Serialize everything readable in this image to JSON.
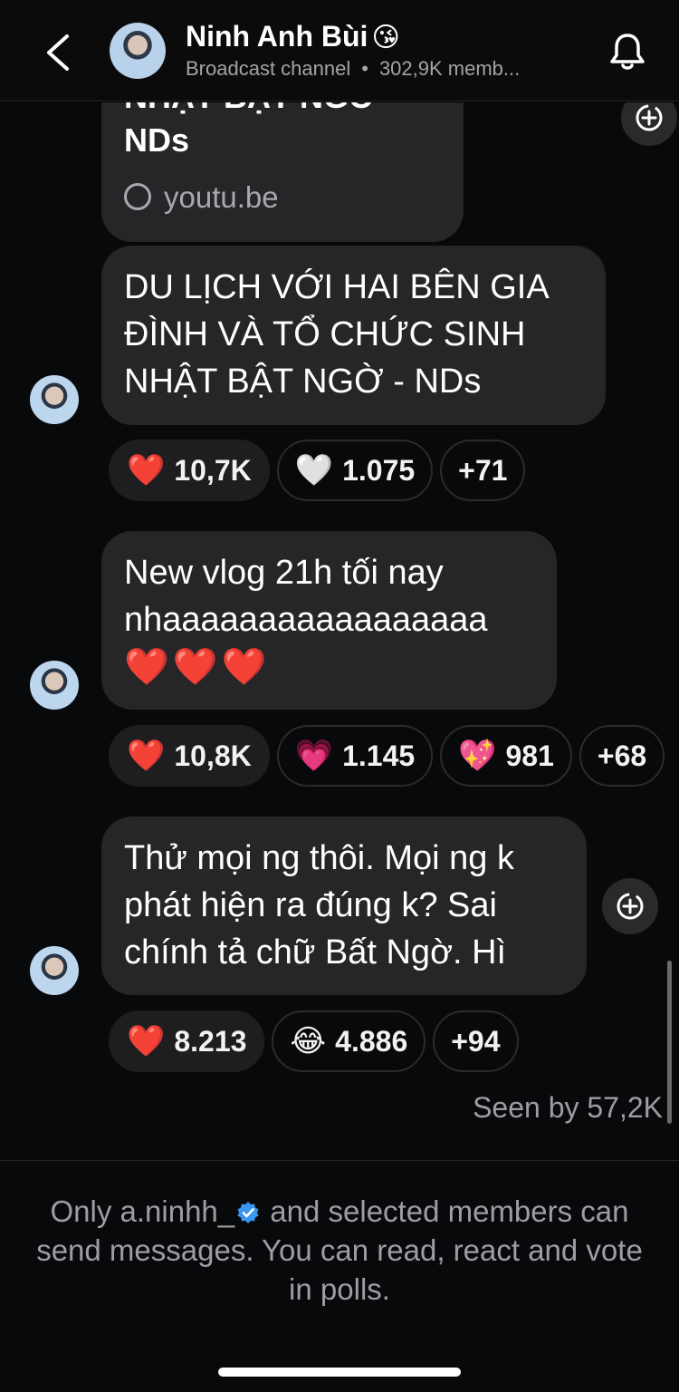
{
  "header": {
    "channel_name": "Ninh Anh Bùi",
    "name_emoji": "😘",
    "channel_type": "Broadcast channel",
    "separator": "•",
    "members": "302,9K memb..."
  },
  "messages": [
    {
      "type": "link_preview",
      "title": "NHẬT BẬT NGỜ - NDs",
      "domain": "youtu.be"
    },
    {
      "type": "text",
      "lines": [
        "DU LỊCH VỚI HAI BÊN GIA",
        "ĐÌNH VÀ TỔ CHỨC SINH",
        "NHẬT BẬT NGỜ - NDs"
      ],
      "reactions": [
        {
          "emoji": "❤️",
          "count": "10,7K"
        },
        {
          "emoji": "🤍",
          "count": "1.075"
        },
        {
          "emoji": "",
          "count": "+71"
        }
      ]
    },
    {
      "type": "text",
      "lines": [
        "New vlog 21h tối nay",
        "nhaaaaaaaaaaaaaaaaa",
        "❤️❤️❤️"
      ],
      "reactions": [
        {
          "emoji": "❤️",
          "count": "10,8K"
        },
        {
          "emoji": "💗",
          "count": "1.145"
        },
        {
          "emoji": "💖",
          "count": "981"
        },
        {
          "emoji": "",
          "count": "+68"
        }
      ]
    },
    {
      "type": "text",
      "lines": [
        "Thử mọi ng thôi. Mọi ng k",
        "phát hiện ra đúng k? Sai",
        "chính tả chữ Bất Ngờ. Hì"
      ],
      "reactions": [
        {
          "emoji": "❤️",
          "count": "8.213"
        },
        {
          "emoji": "😂",
          "count": "4.886"
        },
        {
          "emoji": "",
          "count": "+94"
        }
      ]
    }
  ],
  "seen_by": "Seen by 57,2K",
  "footer": {
    "prefix": "Only a.ninhh_",
    "suffix": " and selected members can send messages. You can read, react and vote in polls."
  },
  "icons": {
    "back": "chevron-left-icon",
    "bell": "bell-icon",
    "share": "share-plus-icon",
    "globe": "globe-icon",
    "verified": "verified-badge-icon"
  },
  "colors": {
    "background": "#000000",
    "bubble": "#262629",
    "secondary_text": "#9e9ea2",
    "verified": "#3897f0"
  }
}
